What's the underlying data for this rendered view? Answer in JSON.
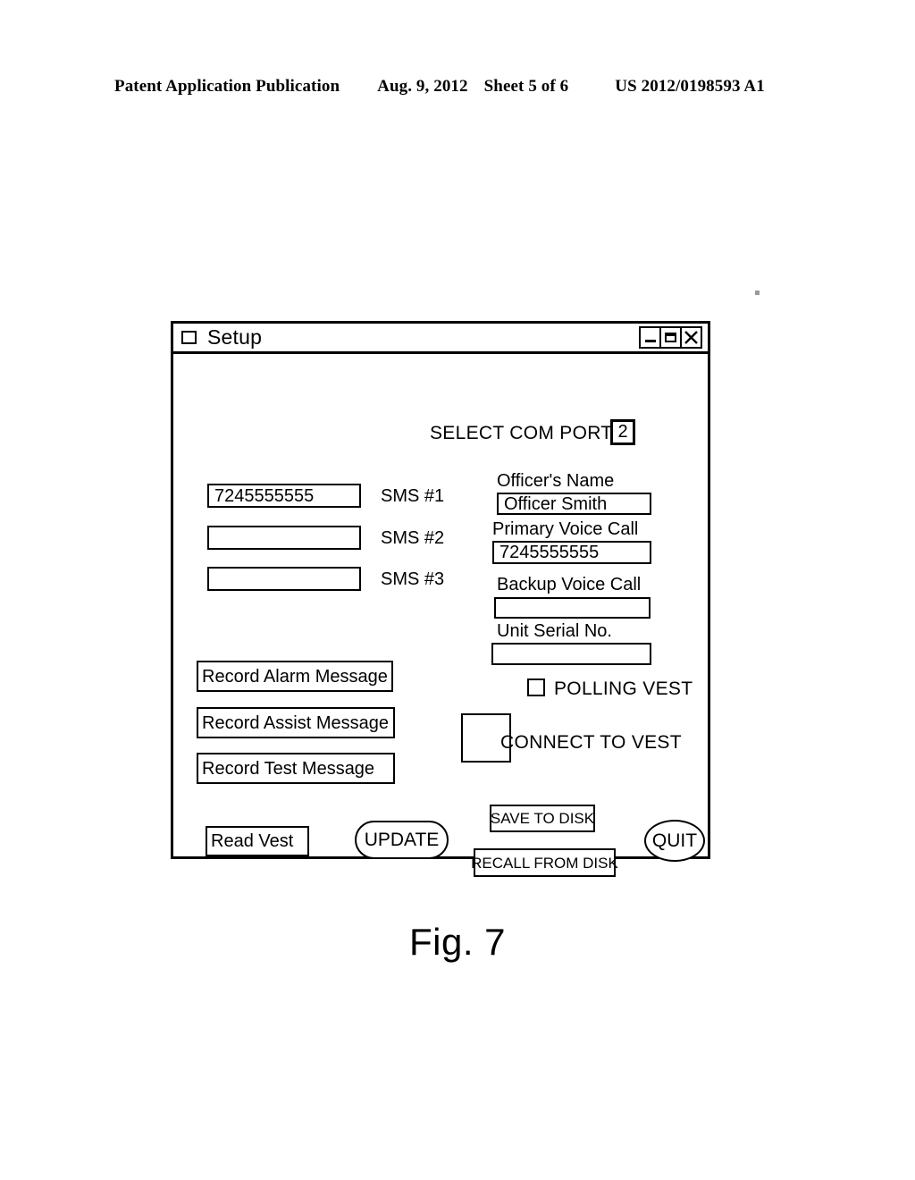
{
  "patent_header": {
    "publication": "Patent Application Publication",
    "date": "Aug. 9, 2012",
    "sheet": "Sheet 5 of 6",
    "number": "US 2012/0198593 A1"
  },
  "figure": {
    "caption": "Fig. 7"
  },
  "window": {
    "title": "Setup",
    "system_icon": "window-square-icon",
    "buttons": {
      "minimize": "minimize-icon",
      "maximize": "maximize-icon",
      "close": "close-icon"
    }
  },
  "com_port": {
    "label": "SELECT COM PORT",
    "value": "2"
  },
  "sms": [
    {
      "label": "SMS #1",
      "value": "7245555555",
      "placeholder": ""
    },
    {
      "label": "SMS #2",
      "value": "",
      "placeholder": ""
    },
    {
      "label": "SMS #3",
      "value": "",
      "placeholder": ""
    }
  ],
  "officer": {
    "name_label": "Officer's Name",
    "name_value": "Officer Smith",
    "primary_label": "Primary Voice Call",
    "primary_value": "7245555555",
    "backup_label": "Backup Voice Call",
    "backup_value": "",
    "serial_label": "Unit Serial No.",
    "serial_value": ""
  },
  "vest": {
    "polling_label": "POLLING VEST",
    "polling_checked": false,
    "connect_label": "CONNECT TO VEST"
  },
  "record_buttons": [
    {
      "label": "Record Alarm Message"
    },
    {
      "label": "Record Assist Message"
    },
    {
      "label": "Record Test Message"
    }
  ],
  "actions": {
    "read_vest": "Read Vest",
    "update": "UPDATE",
    "save_to_disk": "SAVE TO DISK",
    "recall_from_disk": "RECALL FROM DISK",
    "quit": "QUIT"
  }
}
